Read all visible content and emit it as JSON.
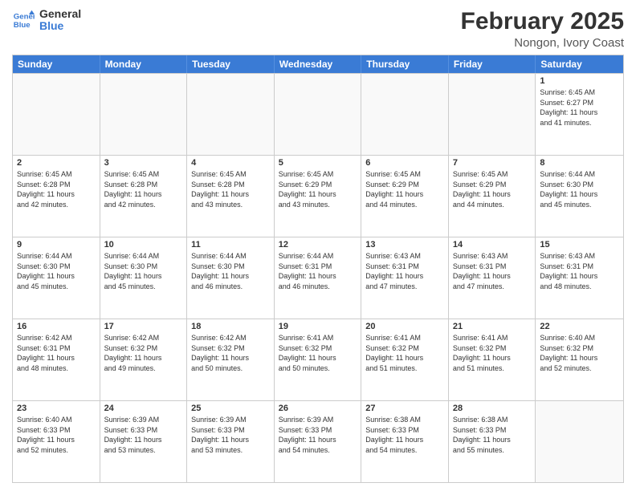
{
  "logo": {
    "line1": "General",
    "line2": "Blue"
  },
  "title": "February 2025",
  "subtitle": "Nongon, Ivory Coast",
  "days": [
    "Sunday",
    "Monday",
    "Tuesday",
    "Wednesday",
    "Thursday",
    "Friday",
    "Saturday"
  ],
  "weeks": [
    [
      {
        "day": "",
        "text": ""
      },
      {
        "day": "",
        "text": ""
      },
      {
        "day": "",
        "text": ""
      },
      {
        "day": "",
        "text": ""
      },
      {
        "day": "",
        "text": ""
      },
      {
        "day": "",
        "text": ""
      },
      {
        "day": "1",
        "text": "Sunrise: 6:45 AM\nSunset: 6:27 PM\nDaylight: 11 hours\nand 41 minutes."
      }
    ],
    [
      {
        "day": "2",
        "text": "Sunrise: 6:45 AM\nSunset: 6:28 PM\nDaylight: 11 hours\nand 42 minutes."
      },
      {
        "day": "3",
        "text": "Sunrise: 6:45 AM\nSunset: 6:28 PM\nDaylight: 11 hours\nand 42 minutes."
      },
      {
        "day": "4",
        "text": "Sunrise: 6:45 AM\nSunset: 6:28 PM\nDaylight: 11 hours\nand 43 minutes."
      },
      {
        "day": "5",
        "text": "Sunrise: 6:45 AM\nSunset: 6:29 PM\nDaylight: 11 hours\nand 43 minutes."
      },
      {
        "day": "6",
        "text": "Sunrise: 6:45 AM\nSunset: 6:29 PM\nDaylight: 11 hours\nand 44 minutes."
      },
      {
        "day": "7",
        "text": "Sunrise: 6:45 AM\nSunset: 6:29 PM\nDaylight: 11 hours\nand 44 minutes."
      },
      {
        "day": "8",
        "text": "Sunrise: 6:44 AM\nSunset: 6:30 PM\nDaylight: 11 hours\nand 45 minutes."
      }
    ],
    [
      {
        "day": "9",
        "text": "Sunrise: 6:44 AM\nSunset: 6:30 PM\nDaylight: 11 hours\nand 45 minutes."
      },
      {
        "day": "10",
        "text": "Sunrise: 6:44 AM\nSunset: 6:30 PM\nDaylight: 11 hours\nand 45 minutes."
      },
      {
        "day": "11",
        "text": "Sunrise: 6:44 AM\nSunset: 6:30 PM\nDaylight: 11 hours\nand 46 minutes."
      },
      {
        "day": "12",
        "text": "Sunrise: 6:44 AM\nSunset: 6:31 PM\nDaylight: 11 hours\nand 46 minutes."
      },
      {
        "day": "13",
        "text": "Sunrise: 6:43 AM\nSunset: 6:31 PM\nDaylight: 11 hours\nand 47 minutes."
      },
      {
        "day": "14",
        "text": "Sunrise: 6:43 AM\nSunset: 6:31 PM\nDaylight: 11 hours\nand 47 minutes."
      },
      {
        "day": "15",
        "text": "Sunrise: 6:43 AM\nSunset: 6:31 PM\nDaylight: 11 hours\nand 48 minutes."
      }
    ],
    [
      {
        "day": "16",
        "text": "Sunrise: 6:42 AM\nSunset: 6:31 PM\nDaylight: 11 hours\nand 48 minutes."
      },
      {
        "day": "17",
        "text": "Sunrise: 6:42 AM\nSunset: 6:32 PM\nDaylight: 11 hours\nand 49 minutes."
      },
      {
        "day": "18",
        "text": "Sunrise: 6:42 AM\nSunset: 6:32 PM\nDaylight: 11 hours\nand 50 minutes."
      },
      {
        "day": "19",
        "text": "Sunrise: 6:41 AM\nSunset: 6:32 PM\nDaylight: 11 hours\nand 50 minutes."
      },
      {
        "day": "20",
        "text": "Sunrise: 6:41 AM\nSunset: 6:32 PM\nDaylight: 11 hours\nand 51 minutes."
      },
      {
        "day": "21",
        "text": "Sunrise: 6:41 AM\nSunset: 6:32 PM\nDaylight: 11 hours\nand 51 minutes."
      },
      {
        "day": "22",
        "text": "Sunrise: 6:40 AM\nSunset: 6:32 PM\nDaylight: 11 hours\nand 52 minutes."
      }
    ],
    [
      {
        "day": "23",
        "text": "Sunrise: 6:40 AM\nSunset: 6:33 PM\nDaylight: 11 hours\nand 52 minutes."
      },
      {
        "day": "24",
        "text": "Sunrise: 6:39 AM\nSunset: 6:33 PM\nDaylight: 11 hours\nand 53 minutes."
      },
      {
        "day": "25",
        "text": "Sunrise: 6:39 AM\nSunset: 6:33 PM\nDaylight: 11 hours\nand 53 minutes."
      },
      {
        "day": "26",
        "text": "Sunrise: 6:39 AM\nSunset: 6:33 PM\nDaylight: 11 hours\nand 54 minutes."
      },
      {
        "day": "27",
        "text": "Sunrise: 6:38 AM\nSunset: 6:33 PM\nDaylight: 11 hours\nand 54 minutes."
      },
      {
        "day": "28",
        "text": "Sunrise: 6:38 AM\nSunset: 6:33 PM\nDaylight: 11 hours\nand 55 minutes."
      },
      {
        "day": "",
        "text": ""
      }
    ]
  ]
}
